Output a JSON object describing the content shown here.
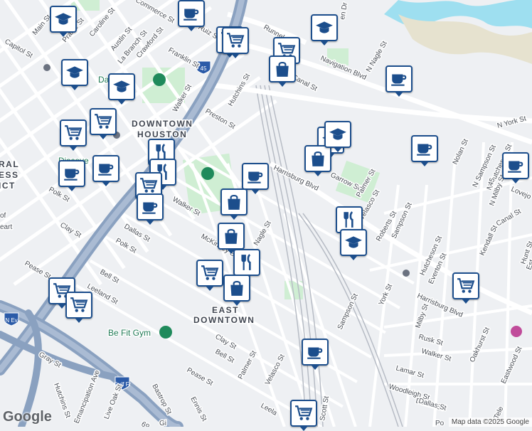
{
  "map": {
    "colors": {
      "land": "#eef0f3",
      "road": "#ffffff",
      "highway": "#8aa1c0",
      "rail": "#b7bcc5",
      "park": "#cfeed3",
      "water": "#9edff0",
      "marker_border": "#1c4e8c"
    },
    "districts": [
      {
        "id": "downtown-houston-1",
        "text": "DOWNTOWN"
      },
      {
        "id": "downtown-houston-2",
        "text": "HOUSTON"
      },
      {
        "id": "east-downtown-1",
        "text": "EAST"
      },
      {
        "id": "east-downtown-2",
        "text": "DOWNTOWN"
      },
      {
        "id": "district-cut-1",
        "text": "RAL"
      },
      {
        "id": "district-cut-2",
        "text": "ESS"
      },
      {
        "id": "district-cut-3",
        "text": "ICT"
      }
    ],
    "streets": [
      {
        "id": "runnels",
        "text": "Runnels St"
      },
      {
        "id": "navigation",
        "text": "Navigation Blvd"
      },
      {
        "id": "canal-north",
        "text": "Canal St"
      },
      {
        "id": "franklin",
        "text": "Franklin St"
      },
      {
        "id": "crawford",
        "text": "Crawford St"
      },
      {
        "id": "caroline",
        "text": "Caroline St"
      },
      {
        "id": "austin",
        "text": "Austin St"
      },
      {
        "id": "labranch",
        "text": "La Branch St"
      },
      {
        "id": "capitol",
        "text": "Capitol St"
      },
      {
        "id": "main",
        "text": "Main St"
      },
      {
        "id": "prairie",
        "text": "Prairie St"
      },
      {
        "id": "commerce",
        "text": "Commerce St"
      },
      {
        "id": "ruiz",
        "text": "Ruiz St"
      },
      {
        "id": "preston",
        "text": "Preston St"
      },
      {
        "id": "hutchins-n",
        "text": "Hutchins St"
      },
      {
        "id": "harrisburg",
        "text": "Harrisburg Blvd"
      },
      {
        "id": "harrisburg-e",
        "text": "Harrisburg Blvd"
      },
      {
        "id": "garrow",
        "text": "Garrow St"
      },
      {
        "id": "walker-w",
        "text": "Walker St"
      },
      {
        "id": "walker-e",
        "text": "Walker St"
      },
      {
        "id": "nagle",
        "text": "Nagle St"
      },
      {
        "id": "n-nagle",
        "text": "N Nagle St"
      },
      {
        "id": "polk-w",
        "text": "Polk St"
      },
      {
        "id": "polk-c",
        "text": "Polk St"
      },
      {
        "id": "clay-w",
        "text": "Clay St"
      },
      {
        "id": "clay-c",
        "text": "Clay St"
      },
      {
        "id": "dallas-w",
        "text": "Dallas St"
      },
      {
        "id": "dallas-e",
        "text": "Dallas St"
      },
      {
        "id": "mckinney",
        "text": "McKinney St"
      },
      {
        "id": "pease-w",
        "text": "Pease St"
      },
      {
        "id": "pease-c",
        "text": "Pease St"
      },
      {
        "id": "bell-w",
        "text": "Bell St"
      },
      {
        "id": "bell-c",
        "text": "Bell St"
      },
      {
        "id": "leeland-w",
        "text": "Leeland St"
      },
      {
        "id": "leeland-c",
        "text": "Leela"
      },
      {
        "id": "gray",
        "text": "Gray St"
      },
      {
        "id": "hutchins-s",
        "text": "Hutchins St"
      },
      {
        "id": "emancipation",
        "text": "Emancipation Ave"
      },
      {
        "id": "live-oak",
        "text": "Live Oak St"
      },
      {
        "id": "bastrop",
        "text": "Bastrop St"
      },
      {
        "id": "ennis",
        "text": "Ennis St"
      },
      {
        "id": "palmer-s",
        "text": "Palmer St"
      },
      {
        "id": "palmer-n",
        "text": "Palmer St"
      },
      {
        "id": "velasco-s",
        "text": "Velasco St"
      },
      {
        "id": "velasco-n",
        "text": "Velasco St"
      },
      {
        "id": "scott",
        "text": "Scott St"
      },
      {
        "id": "sampson-s",
        "text": "Sampson St"
      },
      {
        "id": "sampson-n",
        "text": "Sampson St"
      },
      {
        "id": "n-sampson",
        "text": "N Sampson St"
      },
      {
        "id": "roberts",
        "text": "Roberts St"
      },
      {
        "id": "york",
        "text": "York St"
      },
      {
        "id": "n-york",
        "text": "N York St"
      },
      {
        "id": "milby",
        "text": "Milby St"
      },
      {
        "id": "n-milby",
        "text": "N Milby St"
      },
      {
        "id": "hutcheson",
        "text": "Hutcheson St"
      },
      {
        "id": "n-hutcheson",
        "text": "N Hutcheson St"
      },
      {
        "id": "everton",
        "text": "Everton St"
      },
      {
        "id": "rusk",
        "text": "Rusk St"
      },
      {
        "id": "walker-se",
        "text": "Walker St"
      },
      {
        "id": "lamar",
        "text": "Lamar St"
      },
      {
        "id": "woodleigh",
        "text": "Woodleigh St"
      },
      {
        "id": "dallas-se",
        "text": "Dallas St"
      },
      {
        "id": "oakhurst",
        "text": "Oakhurst St"
      },
      {
        "id": "eastwood",
        "text": "Eastwood St"
      },
      {
        "id": "kendall",
        "text": "Kendall St"
      },
      {
        "id": "canal-e",
        "text": "Canal St"
      },
      {
        "id": "nolan",
        "text": "Nolan St"
      },
      {
        "id": "lovejoy",
        "text": "Lovejo"
      },
      {
        "id": "hunt",
        "text": "Hunt St"
      },
      {
        "id": "esti",
        "text": "Est"
      },
      {
        "id": "n-ev",
        "text": "N Ev"
      },
      {
        "id": "gulf-freeway",
        "text": "Gulf Fr"
      },
      {
        "id": "i45-a",
        "text": "45"
      },
      {
        "id": "i45-b",
        "text": "45"
      },
      {
        "id": "i69",
        "text": "69"
      },
      {
        "id": "of-text",
        "text": "of"
      },
      {
        "id": "eart-text",
        "text": "eart"
      },
      {
        "id": "dn-st",
        "text": "en Dr"
      },
      {
        "id": "telc",
        "text": "Tele"
      },
      {
        "id": "pol-cut",
        "text": "Po"
      },
      {
        "id": "gi-cut",
        "text": "Gi"
      }
    ],
    "pois": [
      {
        "id": "discovery",
        "text": "Discove"
      },
      {
        "id": "be-fit-gym",
        "text": "Be Fit Gym"
      },
      {
        "id": "dak-park",
        "text": "Da    ark"
      }
    ],
    "markers": [
      {
        "id": "m1",
        "icon": "graduation-cap-icon"
      },
      {
        "id": "m2",
        "icon": "coffee-cup-icon"
      },
      {
        "id": "m3",
        "icon": "shopping-cart-icon"
      },
      {
        "id": "m4",
        "icon": "shopping-cart-icon"
      },
      {
        "id": "m5",
        "icon": "graduation-cap-icon"
      },
      {
        "id": "m6",
        "icon": "shopping-cart-icon"
      },
      {
        "id": "m7",
        "icon": "shopping-bag-icon"
      },
      {
        "id": "m8",
        "icon": "graduation-cap-icon"
      },
      {
        "id": "m9",
        "icon": "graduation-cap-icon"
      },
      {
        "id": "m10",
        "icon": "coffee-cup-icon"
      },
      {
        "id": "m11",
        "icon": "shopping-cart-icon"
      },
      {
        "id": "m12",
        "icon": "shopping-cart-icon"
      },
      {
        "id": "m13",
        "icon": "graduation-cap-icon"
      },
      {
        "id": "m14",
        "icon": "shopping-bag-icon"
      },
      {
        "id": "m15",
        "icon": "coffee-cup-icon"
      },
      {
        "id": "m16",
        "icon": "coffee-cup-icon"
      },
      {
        "id": "m17",
        "icon": "coffee-cup-icon"
      },
      {
        "id": "m18",
        "icon": "fork-knife-icon"
      },
      {
        "id": "m19",
        "icon": "fork-knife-icon"
      },
      {
        "id": "m20",
        "icon": "shopping-cart-icon"
      },
      {
        "id": "m21",
        "icon": "coffee-cup-icon"
      },
      {
        "id": "m22",
        "icon": "coffee-cup-icon"
      },
      {
        "id": "m23",
        "icon": "shopping-bag-icon"
      },
      {
        "id": "m24",
        "icon": "fork-knife-icon"
      },
      {
        "id": "m25",
        "icon": "graduation-cap-icon"
      },
      {
        "id": "m26",
        "icon": "shopping-bag-icon"
      },
      {
        "id": "m27",
        "icon": "fork-knife-icon"
      },
      {
        "id": "m28",
        "icon": "shopping-cart-icon"
      },
      {
        "id": "m29",
        "icon": "shopping-bag-icon"
      },
      {
        "id": "m30",
        "icon": "shopping-cart-icon"
      },
      {
        "id": "m31",
        "icon": "shopping-cart-icon"
      },
      {
        "id": "m32",
        "icon": "shopping-cart-icon"
      },
      {
        "id": "m33",
        "icon": "coffee-cup-icon"
      },
      {
        "id": "m34",
        "icon": "shopping-cart-icon"
      },
      {
        "id": "m35",
        "icon": "coffee-cup-icon"
      },
      {
        "id": "m36",
        "icon": "graduation-cap-icon"
      }
    ]
  },
  "footer": {
    "logo": "Google",
    "attribution": "Map data ©2025 Google"
  }
}
